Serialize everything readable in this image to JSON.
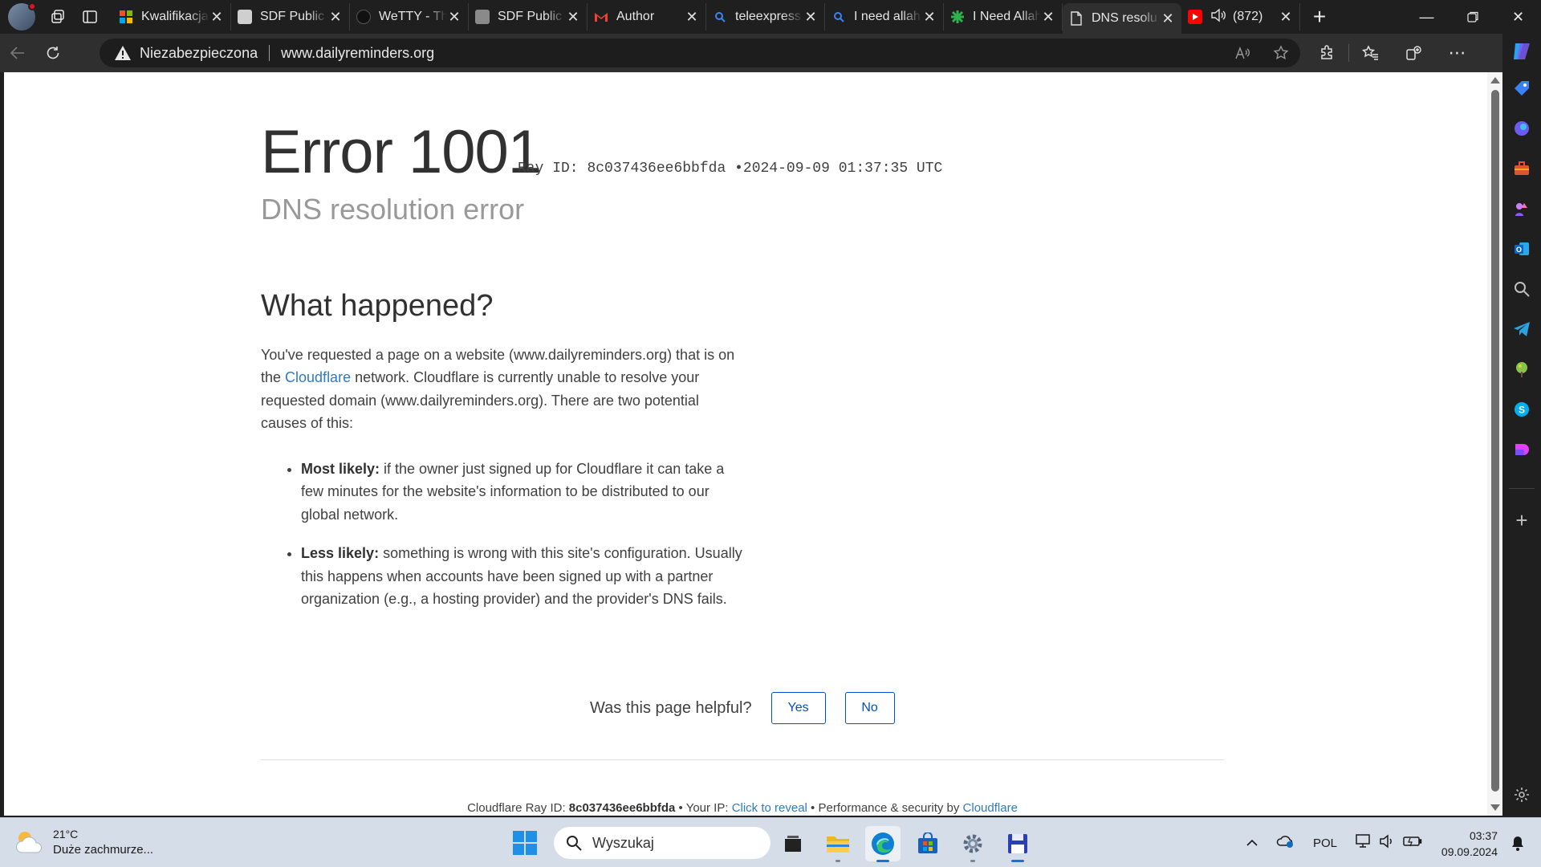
{
  "browser": {
    "tabs": [
      {
        "title": "Kwalifikacja",
        "favicon": "ms-grid-icon",
        "color": "#f25022"
      },
      {
        "title": "SDF Public",
        "favicon": "sdf-icon",
        "color": "#cfcfcf"
      },
      {
        "title": "WeTTY - Th",
        "favicon": "github-icon",
        "color": "#111111"
      },
      {
        "title": "SDF Public",
        "favicon": "sdf-gray-icon",
        "color": "#8a8a8a"
      },
      {
        "title": "Author",
        "favicon": "gmail-icon",
        "color": "#ea4335"
      },
      {
        "title": "teleexpress",
        "favicon": "search-icon",
        "color": "#3b82f6"
      },
      {
        "title": "I need allah",
        "favicon": "search-icon",
        "color": "#3b82f6"
      },
      {
        "title": "I Need Allah",
        "favicon": "asterisk-icon",
        "color": "#2fb24c"
      },
      {
        "title": "DNS resolu",
        "favicon": "page-icon",
        "color": "#e0e0e0",
        "active": true
      },
      {
        "title": "(872)",
        "favicon": "youtube-icon",
        "color": "#ff0000",
        "audio": true
      }
    ],
    "address": {
      "security_label": "Niezabezpieczona",
      "url": "www.dailyreminders.org"
    }
  },
  "page": {
    "error_title": "Error 1001",
    "ray_prefix": "Ray ID:",
    "ray_id": "8c037436ee6bbfda",
    "bullet": "•",
    "timestamp": "2024-09-09 01:37:35 UTC",
    "subtitle": "DNS resolution error",
    "what_happened": {
      "heading": "What happened?",
      "para_before_link": "You've requested a page on a website (www.dailyreminders.org) that is on the ",
      "link_text": "Cloudflare",
      "para_after_link": " network. Cloudflare is currently unable to resolve your requested domain (www.dailyreminders.org). There are two potential causes of this:",
      "causes": [
        {
          "label": "Most likely:",
          "text": " if the owner just signed up for Cloudflare it can take a few minutes for the website's information to be distributed to our global network."
        },
        {
          "label": "Less likely:",
          "text": " something is wrong with this site's configuration. Usually this happens when accounts have been signed up with a partner organization (e.g., a hosting provider) and the provider's DNS fails."
        }
      ]
    },
    "feedback": {
      "question": "Was this page helpful?",
      "yes": "Yes",
      "no": "No"
    },
    "footer": {
      "ray_label": "Cloudflare Ray ID: ",
      "ray_id": "8c037436ee6bbfda",
      "sep1": " • Your IP: ",
      "reveal": "Click to reveal",
      "sep2": " • Performance & security by ",
      "brand": "Cloudflare"
    }
  },
  "taskbar": {
    "weather_temp": "21°C",
    "weather_desc": "Duże zachmurze...",
    "search_placeholder": "Wyszukaj",
    "language": "POL",
    "time": "03:37",
    "date": "09.09.2024"
  }
}
